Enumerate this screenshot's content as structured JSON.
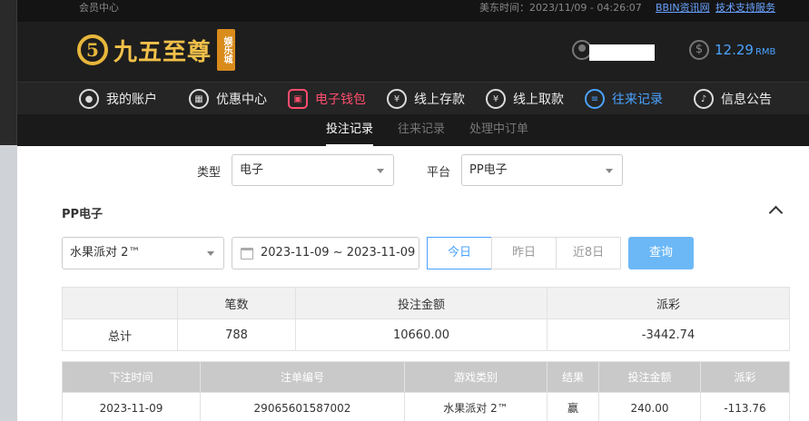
{
  "topbar": {
    "member_center": "会员中心",
    "time_label": "美东时间：2023/11/09 - 04:26:07",
    "link_info": "BBIN资讯网",
    "link_support": "技术支持服务"
  },
  "header": {
    "logo_text": "九五至尊",
    "logo_tag": "娱乐城",
    "balance": "12.29",
    "balance_unit": "RMB"
  },
  "nav": {
    "items": [
      {
        "label": "我的账户",
        "icon": "user-icon"
      },
      {
        "label": "优惠中心",
        "icon": "gift-icon"
      },
      {
        "label": "电子钱包",
        "icon": "wallet-icon"
      },
      {
        "label": "线上存款",
        "icon": "deposit-icon"
      },
      {
        "label": "线上取款",
        "icon": "withdraw-icon"
      },
      {
        "label": "往来记录",
        "icon": "record-icon"
      },
      {
        "label": "信息公告",
        "icon": "bell-icon"
      }
    ],
    "active_index": 5
  },
  "subnav": {
    "tabs": [
      "投注记录",
      "往来记录",
      "处理中订单"
    ]
  },
  "filters": {
    "type_label": "类型",
    "type_value": "电子",
    "platform_label": "平台",
    "platform_value": "PP电子"
  },
  "section": {
    "title": "PP电子",
    "game_value": "水果派对 2™",
    "date_range": "2023-11-09 ~ 2023-11-09",
    "quick": [
      "今日",
      "昨日",
      "近8日"
    ],
    "query_label": "查询"
  },
  "summary": {
    "headers": [
      "",
      "笔数",
      "投注金额",
      "派彩"
    ],
    "row": [
      "总计",
      "788",
      "10660.00",
      "-3442.74"
    ]
  },
  "details": {
    "headers": [
      "下注时间",
      "注单编号",
      "游戏类别",
      "结果",
      "投注金额",
      "派彩"
    ],
    "rows": [
      [
        "2023-11-09",
        "29065601587002",
        "水果派对 2™",
        "赢",
        "240.00",
        "-113.76"
      ]
    ]
  }
}
